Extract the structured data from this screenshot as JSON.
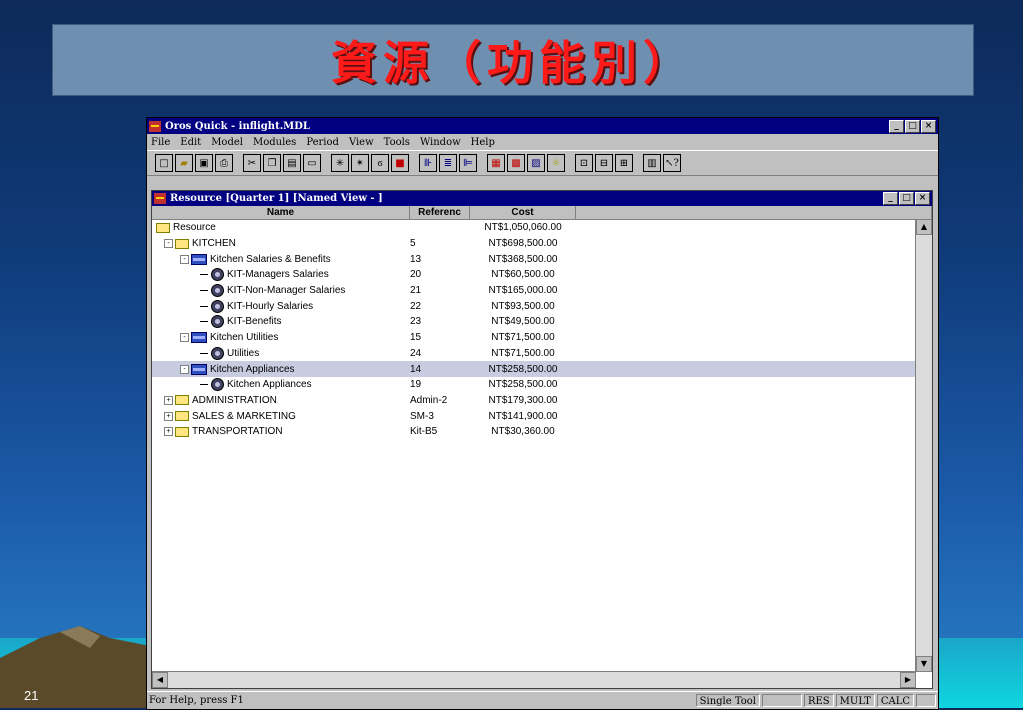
{
  "slide": {
    "title": "資源（功能別）",
    "number": "21"
  },
  "app": {
    "title": "Oros Quick - inflight.MDL",
    "window_buttons": [
      "_",
      "□",
      "×"
    ],
    "menu": [
      "File",
      "Edit",
      "Model",
      "Modules",
      "Period",
      "View",
      "Tools",
      "Window",
      "Help"
    ],
    "toolbar_icons": [
      "new-icon",
      "open-icon",
      "save-icon",
      "print-icon",
      "cut-icon",
      "copy-icon",
      "paste-icon",
      "paste-special-icon",
      "new-item-icon",
      "new-child-icon",
      "link-icon",
      "delete-icon",
      "indent-icon",
      "tree-view-icon",
      "outdent-icon",
      "grid-icon",
      "graph-icon",
      "chart-icon",
      "idea-icon",
      "folder-up-icon",
      "folder-icon",
      "folder-down-icon",
      "calculate-icon",
      "help-pointer-icon"
    ]
  },
  "child_window": {
    "title": "Resource [Quarter 1] [Named View - ]",
    "window_buttons": [
      "_",
      "□",
      "×"
    ],
    "columns": {
      "name": "Name",
      "reference": "Referenc",
      "cost": "Cost"
    },
    "rows": [
      {
        "name": "Resource",
        "reference": "",
        "cost": "NT$1,050,060.00",
        "icon": "folder-icon",
        "level": 0,
        "expander": ""
      },
      {
        "name": "KITCHEN",
        "reference": "5",
        "cost": "NT$698,500.00",
        "icon": "folder-icon",
        "level": 1,
        "expander": "-"
      },
      {
        "name": "Kitchen Salaries & Benefits",
        "reference": "13",
        "cost": "NT$368,500.00",
        "icon": "table-icon",
        "level": 2,
        "expander": "-"
      },
      {
        "name": "KIT-Managers Salaries",
        "reference": "20",
        "cost": "NT$60,500.00",
        "icon": "resource-icon",
        "level": 3,
        "expander": ""
      },
      {
        "name": "KIT-Non-Manager Salaries",
        "reference": "21",
        "cost": "NT$165,000.00",
        "icon": "resource-icon",
        "level": 3,
        "expander": ""
      },
      {
        "name": "KIT-Hourly Salaries",
        "reference": "22",
        "cost": "NT$93,500.00",
        "icon": "resource-icon",
        "level": 3,
        "expander": ""
      },
      {
        "name": "KIT-Benefits",
        "reference": "23",
        "cost": "NT$49,500.00",
        "icon": "resource-icon",
        "level": 3,
        "expander": ""
      },
      {
        "name": "Kitchen Utilities",
        "reference": "15",
        "cost": "NT$71,500.00",
        "icon": "table-icon",
        "level": 2,
        "expander": "-"
      },
      {
        "name": "Utilities",
        "reference": "24",
        "cost": "NT$71,500.00",
        "icon": "resource-icon",
        "level": 3,
        "expander": ""
      },
      {
        "name": "Kitchen Appliances",
        "reference": "14",
        "cost": "NT$258,500.00",
        "icon": "table-icon",
        "level": 2,
        "expander": "-",
        "selected": true
      },
      {
        "name": "Kitchen Appliances",
        "reference": "19",
        "cost": "NT$258,500.00",
        "icon": "resource-icon",
        "level": 3,
        "expander": ""
      },
      {
        "name": "ADMINISTRATION",
        "reference": "Admin-2",
        "cost": "NT$179,300.00",
        "icon": "folder-icon",
        "level": 1,
        "expander": "+"
      },
      {
        "name": "SALES & MARKETING",
        "reference": "SM-3",
        "cost": "NT$141,900.00",
        "icon": "folder-icon",
        "level": 1,
        "expander": "+"
      },
      {
        "name": "TRANSPORTATION",
        "reference": "Kit-B5",
        "cost": "NT$30,360.00",
        "icon": "folder-icon",
        "level": 1,
        "expander": "+"
      }
    ]
  },
  "statusbar": {
    "help": "For Help, press F1",
    "mode": "Single Tool",
    "indicators": [
      "RES",
      "MULT",
      "CALC"
    ]
  }
}
